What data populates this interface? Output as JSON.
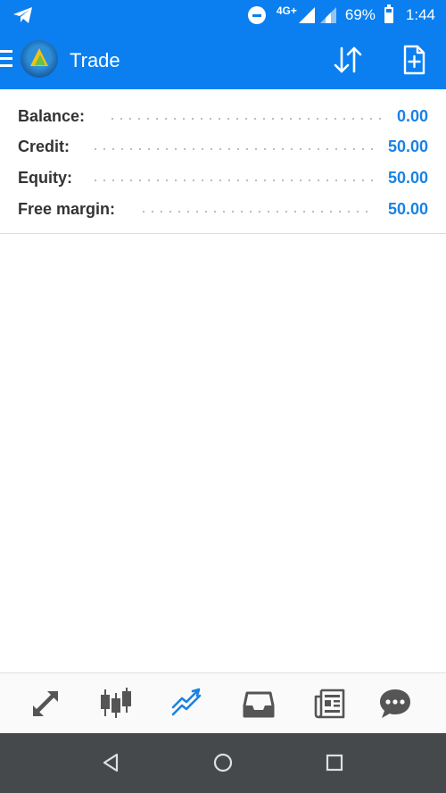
{
  "status_bar": {
    "network": "4G+",
    "battery_percent": "69%",
    "time": "1:44",
    "left_icon": "telegram-icon"
  },
  "toolbar": {
    "title": "Trade",
    "sort_icon": "sort-icon",
    "new_order_icon": "new-order-icon"
  },
  "account": {
    "rows": [
      {
        "label": "Balance:",
        "value": "0.00"
      },
      {
        "label": "Credit:",
        "value": "50.00"
      },
      {
        "label": "Equity:",
        "value": "50.00"
      },
      {
        "label": "Free margin:",
        "value": "50.00"
      }
    ]
  },
  "bottom_nav": {
    "items": [
      {
        "icon": "quotes-icon"
      },
      {
        "icon": "chart-icon"
      },
      {
        "icon": "trade-icon",
        "active": true
      },
      {
        "icon": "history-icon"
      },
      {
        "icon": "news-icon"
      },
      {
        "icon": "messages-icon"
      }
    ]
  },
  "colors": {
    "primary": "#0b7ff0",
    "value_blue": "#1a82e2",
    "label": "#333333",
    "nav_icon": "#555555",
    "nav_active": "#1a82e2",
    "system_nav": "#45494c"
  }
}
